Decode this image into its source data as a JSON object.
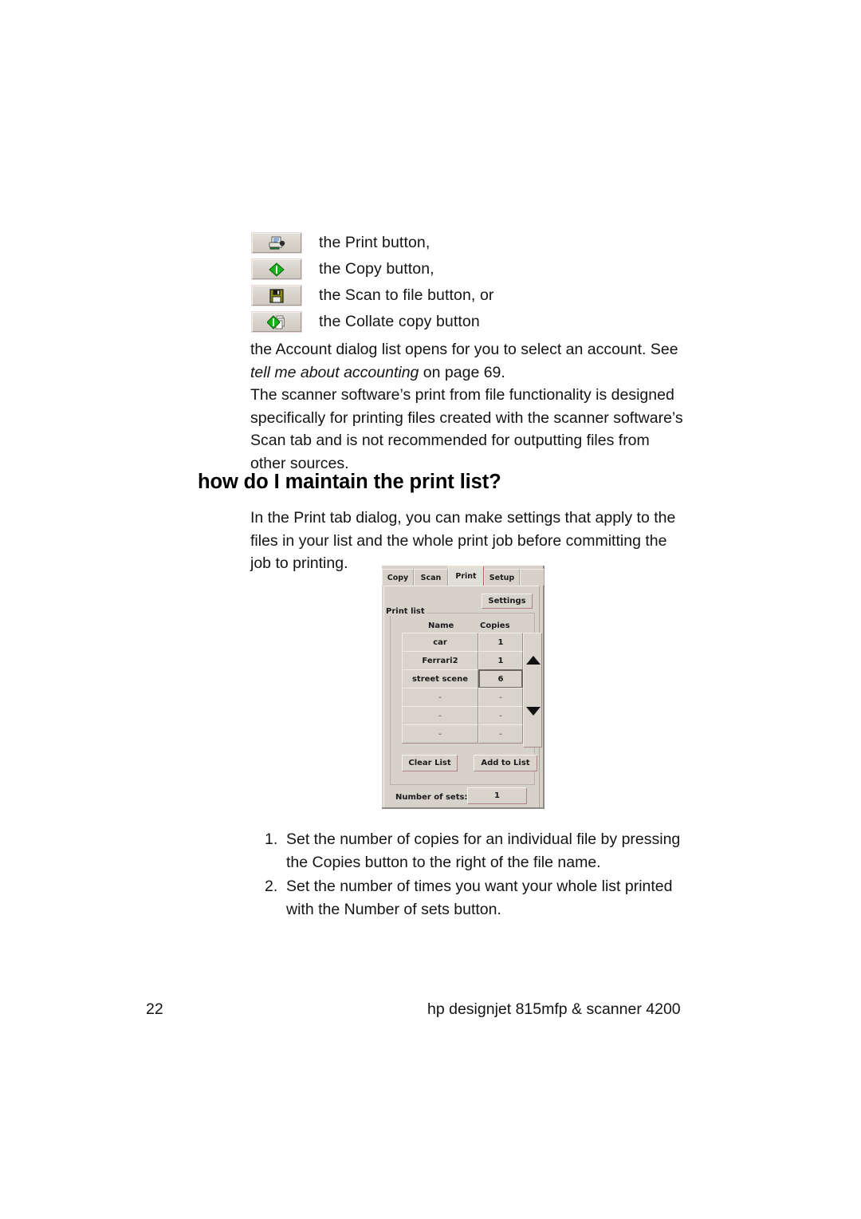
{
  "page": {
    "number": "22",
    "product": "hp designjet 815mfp & scanner 4200"
  },
  "icon_list": [
    {
      "icon": "printer-icon",
      "label": "the Print button,"
    },
    {
      "icon": "copy-diamond-icon",
      "label": "the Copy button,"
    },
    {
      "icon": "floppy-save-icon",
      "label": "the Scan to file button, or"
    },
    {
      "icon": "collate-copy-icon",
      "label": "the Collate copy button"
    }
  ],
  "paragraphs": {
    "account_pre": "the Account dialog list opens for you to select an account. See ",
    "account_italic": "tell me about accounting",
    "account_post": " on page 69.",
    "scanner": "The scanner software’s print from file functionality is designed specifically for printing files created with the scanner software’s Scan tab and is not recommended for outputting files from other sources.",
    "intro": "In the Print tab dialog, you can make settings that apply to the files in your list and the whole print job before committing the job to printing."
  },
  "heading": "how do I maintain the print list?",
  "numbered_list": [
    {
      "marker": "1.",
      "text": "Set the number of copies for an individual file by pressing the Copies button to the right of the file name."
    },
    {
      "marker": "2.",
      "text": "Set the number of times you want your whole list printed with the Number of sets button."
    }
  ],
  "dialog": {
    "tabs": [
      {
        "label": "Copy",
        "selected": false
      },
      {
        "label": "Scan",
        "selected": false
      },
      {
        "label": "Print",
        "selected": true
      },
      {
        "label": "Setup",
        "selected": false
      }
    ],
    "settings_button": "Settings",
    "group_title": "Print list",
    "columns": {
      "name": "Name",
      "copies": "Copies"
    },
    "rows": [
      {
        "name": "car",
        "copies": "1",
        "focused": false,
        "empty": false
      },
      {
        "name": "Ferrari2",
        "copies": "1",
        "focused": false,
        "empty": false
      },
      {
        "name": "street scene",
        "copies": "6",
        "focused": true,
        "empty": false
      },
      {
        "name": "-",
        "copies": "-",
        "focused": false,
        "empty": true
      },
      {
        "name": "-",
        "copies": "-",
        "focused": false,
        "empty": true
      },
      {
        "name": "-",
        "copies": "-",
        "focused": false,
        "empty": true
      }
    ],
    "clear_list_button": "Clear List",
    "add_to_list_button": "Add to List",
    "number_of_sets_label": "Number of sets:",
    "number_of_sets_value": "1",
    "scroll_up_icon": "triangle-up-icon",
    "scroll_down_icon": "triangle-down-icon"
  },
  "colors": {
    "dialog_face": "#d6d2ca",
    "button_face": "#d8d4cc",
    "shadow": "#b0837f",
    "highlight": "#f4f2ed",
    "text": "#1a1a1a",
    "paper": "#ffffff"
  }
}
